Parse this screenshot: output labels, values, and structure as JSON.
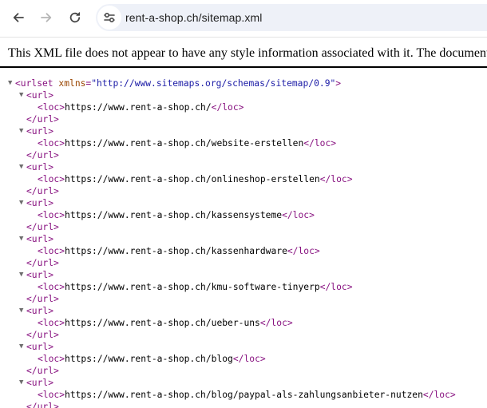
{
  "toolbar": {
    "back_icon": "arrow-left-icon",
    "forward_icon": "arrow-right-icon",
    "reload_icon": "reload-icon",
    "site_info_icon": "tune-icon",
    "url": "rent-a-shop.ch/sitemap.xml"
  },
  "banner": {
    "text": "This XML file does not appear to have any style information associated with it. The document tree is shown below."
  },
  "xml": {
    "root_open_tag": "<urlset",
    "root_attr_name": " xmlns",
    "root_attr_eq": "=",
    "root_attr_value": "\"http://www.sitemaps.org/schemas/sitemap/0.9\"",
    "root_close_bracket": ">",
    "url_open": "<url>",
    "url_close": "</url>",
    "loc_open": "<loc>",
    "loc_close": "</loc>",
    "toggle_glyph": "▼",
    "urls": [
      "https://www.rent-a-shop.ch/",
      "https://www.rent-a-shop.ch/website-erstellen",
      "https://www.rent-a-shop.ch/onlineshop-erstellen",
      "https://www.rent-a-shop.ch/kassensysteme",
      "https://www.rent-a-shop.ch/kassenhardware",
      "https://www.rent-a-shop.ch/kmu-software-tinyerp",
      "https://www.rent-a-shop.ch/ueber-uns",
      "https://www.rent-a-shop.ch/blog",
      "https://www.rent-a-shop.ch/blog/paypal-als-zahlungsanbieter-nutzen"
    ]
  }
}
